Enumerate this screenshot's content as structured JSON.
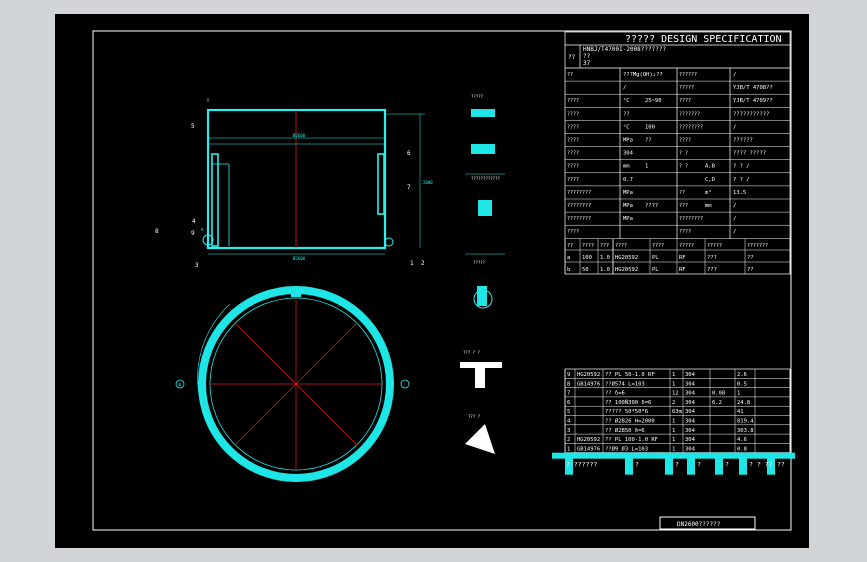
{
  "spec": {
    "title": "?????  DESIGN  SPECIFICATION",
    "std_label": "??",
    "std_line1": "HNBJ/T4700I-2008???????",
    "std_line2": "??",
    "std_line3": "37",
    "rows": [
      {
        "c1": "??",
        "c2": "???Mg(OH)₂??",
        "c3": "??????",
        "c4": "/"
      },
      {
        "c1": "",
        "c2": "/",
        "c3": "?????",
        "c4": "YJB/T 4708??"
      },
      {
        "c1": "????",
        "c2": "°C",
        "c2b": "25~90",
        "c3": "????",
        "c4": "YJB/T 4709??"
      },
      {
        "c1": "????",
        "c2": "??",
        "c3": "???????",
        "c4": "???????????"
      },
      {
        "c1": "????",
        "c2": "°C",
        "c2b": "100",
        "c3": "????????",
        "c4": "/"
      },
      {
        "c1": "????",
        "c2": "MPa",
        "c2b": "??",
        "c3": "????",
        "c4": "??????"
      },
      {
        "c1": "????",
        "c2": "304",
        "c3": "? ?",
        "c4": "????  ?????"
      },
      {
        "c1": "????",
        "c2": "mm",
        "c2b": "1",
        "c3": "? ?",
        "c3b": "A,B",
        "c4": "?  ?  /"
      },
      {
        "c1": "????",
        "c2": "0.7",
        "c3": "",
        "c3b": "C,D",
        "c4": "?  ?  /"
      },
      {
        "c1": "????????",
        "c2": "MPa",
        "c3": "??",
        "c3b": "m³",
        "c4": "13.5"
      },
      {
        "c1": "????????",
        "c2": "MPa",
        "c2b": "????",
        "c3": "???",
        "c3b": "mm",
        "c4": "/"
      },
      {
        "c1": "????????",
        "c2": "MPa",
        "c3": "????????",
        "c4": "/"
      },
      {
        "c1": "????",
        "c2": "",
        "c3": "????",
        "c4": "/"
      }
    ],
    "nozzle_header": [
      "??",
      "????",
      "???",
      "????",
      "????",
      "?????",
      "?????",
      "???????"
    ],
    "nozzles": [
      [
        "a",
        "100",
        "1.0",
        "HG20592",
        "PL",
        "RF",
        "???",
        "??"
      ],
      [
        "b",
        "50",
        "1.0",
        "HG20592",
        "PL",
        "RF",
        "???",
        "??"
      ]
    ]
  },
  "bom": {
    "rows": [
      [
        "9",
        "HG20592",
        "?? PL 50-1.0 RF",
        "1",
        "304",
        "",
        "2.6"
      ],
      [
        "8",
        "GB14976",
        "??Ø574 L=103",
        "1",
        "304",
        "",
        "0.5"
      ],
      [
        "7",
        "",
        "??  δ=6",
        "12",
        "304",
        "0.08",
        "1"
      ],
      [
        "6",
        "",
        "?? 100Ñ300 δ=6",
        "2",
        "304",
        "6.2",
        "24.8"
      ],
      [
        "5",
        "",
        "????? 50*50*6",
        "63m",
        "304",
        "",
        "41"
      ],
      [
        "4",
        "",
        "??  Ø2B26 H=2000",
        "1",
        "304",
        "",
        "819.4"
      ],
      [
        "3",
        "",
        "??  Ø2B50 δ=6",
        "1",
        "304",
        "",
        "303.8"
      ],
      [
        "2",
        "HG20592",
        "?? PL 100-1.0 RF",
        "1",
        "304",
        "",
        "4.6"
      ],
      [
        "1",
        "GB14976",
        "??Ø9 Ø3 L=103",
        "1",
        "304",
        "",
        "0.8"
      ]
    ],
    "footer": [
      "? ??????",
      "?",
      "?",
      "?",
      "?",
      "? ? ??",
      "??"
    ]
  },
  "drawing": {
    "title_block": "DN2600??????",
    "labels": {
      "l1": "1",
      "l2": "2",
      "l3": "3",
      "l4": "4",
      "l5": "5",
      "l6": "6",
      "l7": "7",
      "l8": "8",
      "l9": "9",
      "dim_top": "Ø2600",
      "dim_bottom": "Ø2600",
      "dim_right": "2000",
      "detail_q1": "?????",
      "detail_q2": "????????????",
      "detail_q3": "?????",
      "detail_q4": "??? ? ?",
      "detail_q5": "??? ?",
      "circ_a": "a",
      "circ_b": "b"
    }
  },
  "colors": {
    "frame": "#ffffff",
    "line": "#26f0f0",
    "fill": "#1fe6e6",
    "center": "#e31b1b",
    "bg": "#000000"
  }
}
